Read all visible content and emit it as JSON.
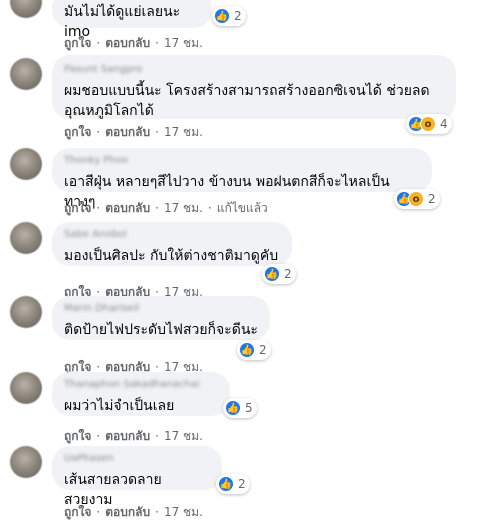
{
  "comments": [
    {
      "author": "",
      "text": "มันไม่ได้ดูแย่เลยนะ imo",
      "react_count": "2",
      "like": "ถูกใจ",
      "reply": "ตอบกลับ",
      "time": "17 ชม.",
      "edited": ""
    },
    {
      "author": "Pasunt Sangpro",
      "text": "ผมชอบแบบนี้นะ โครงสร้างสามารถสร้างออกซิเจนได้ ช่วยลด\nอุณหภูมิโลกได้",
      "react_count": "4",
      "like": "ถูกใจ",
      "reply": "ตอบกลับ",
      "time": "17 ชม.",
      "edited": ""
    },
    {
      "author": "Thonky Phoo",
      "text": "เอาสีฝุ่น หลายๆสีไปวาง ข้างบน พอฝนตกสีก็จะไหลเป็นทางๆ",
      "react_count": "2",
      "like": "ถูกใจ",
      "reply": "ตอบกลับ",
      "time": "17 ชม.",
      "edited": "แก้ไขแล้ว"
    },
    {
      "author": "Sabe Anobol",
      "text": "มองเป็นศิลปะ กับให้ต่างชาติมาดูคับ",
      "react_count": "2",
      "like": "ถูกใจ",
      "reply": "ตอบกลับ",
      "time": "17 ชม.",
      "edited": ""
    },
    {
      "author": "Marin Dhariseil",
      "text": "ติดป้ายไฟประดับไฟสวยก็จะดีนะ",
      "react_count": "2",
      "like": "ถูกใจ",
      "reply": "ตอบกลับ",
      "time": "17 ชม.",
      "edited": ""
    },
    {
      "author": "Thanaphon Sakadhanachai",
      "text": "ผมว่าไม่จำเป็นเลย",
      "react_count": "5",
      "like": "ถูกใจ",
      "reply": "ตอบกลับ",
      "time": "17 ชม.",
      "edited": ""
    },
    {
      "author": "UaPhasen",
      "text": "เส้นสายลวดลายสวยงาม",
      "react_count": "2",
      "like": "ถูกใจ",
      "reply": "ตอบกลับ",
      "time": "17 ชม.",
      "edited": ""
    }
  ],
  "icons": {
    "like": "thumbs-up-icon",
    "wow": "wow-face-icon"
  },
  "colors": {
    "like_blue": "#1877f2",
    "wow_yellow": "#f7b125",
    "bubble": "#f0f2f5"
  }
}
